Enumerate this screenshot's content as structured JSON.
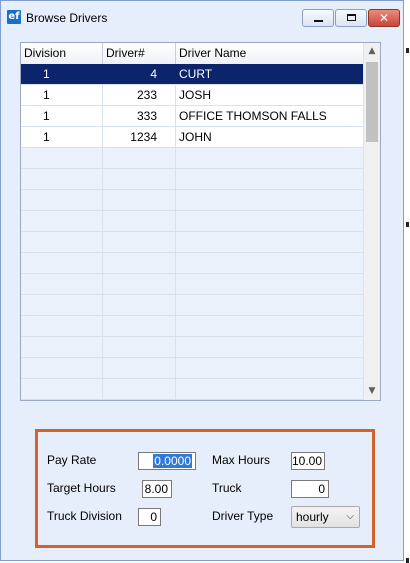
{
  "window": {
    "title": "Browse Drivers",
    "icon_text": "ef",
    "close_glyph": "✕"
  },
  "grid": {
    "columns": [
      "Division",
      "Driver#",
      "Driver Name"
    ],
    "rows": [
      {
        "division": "1",
        "driver_num": "4",
        "driver_name": "CURT",
        "selected": true
      },
      {
        "division": "1",
        "driver_num": "233",
        "driver_name": "JOSH",
        "selected": false
      },
      {
        "division": "1",
        "driver_num": "333",
        "driver_name": "OFFICE THOMSON FALLS",
        "selected": false
      },
      {
        "division": "1",
        "driver_num": "1234",
        "driver_name": "JOHN",
        "selected": false
      }
    ],
    "scroll_up_glyph": "▲",
    "scroll_down_glyph": "▼"
  },
  "form": {
    "pay_rate_label": "Pay Rate",
    "pay_rate_value": "0.0000",
    "max_hours_label": "Max Hours",
    "max_hours_value": "10.00",
    "target_hours_label": "Target Hours",
    "target_hours_value": "8.00",
    "truck_label": "Truck",
    "truck_value": "0",
    "truck_division_label": "Truck Division",
    "truck_division_value": "0",
    "driver_type_label": "Driver Type",
    "driver_type_value": "hourly",
    "chevron_glyph": "⌵"
  },
  "colors": {
    "selection": "#0c246b",
    "window_bg": "#e6eefb",
    "highlight_border": "#d0642b"
  }
}
